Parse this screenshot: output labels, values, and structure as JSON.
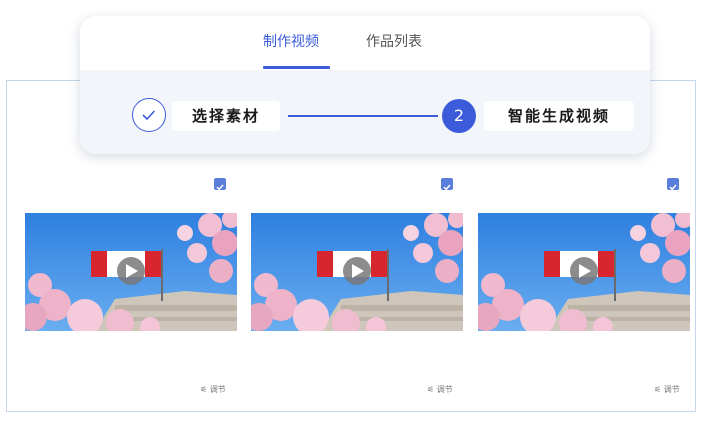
{
  "tabs": [
    {
      "label": "制作视频",
      "active": true
    },
    {
      "label": "作品列表",
      "active": false
    }
  ],
  "steps": [
    {
      "label": "选择素材",
      "status": "done",
      "icon": "check-icon"
    },
    {
      "number": "2",
      "label": "智能生成视频",
      "status": "current"
    }
  ],
  "videos": [
    {
      "checked": true,
      "adjust_label": "调节",
      "icon": "play-icon"
    },
    {
      "checked": true,
      "adjust_label": "调节",
      "icon": "play-icon"
    },
    {
      "checked": true,
      "adjust_label": "调节",
      "icon": "play-icon"
    }
  ],
  "colors": {
    "accent": "#3b5bdb",
    "checkbox": "#5b7ddb",
    "frame_border": "#c5d6ec"
  }
}
